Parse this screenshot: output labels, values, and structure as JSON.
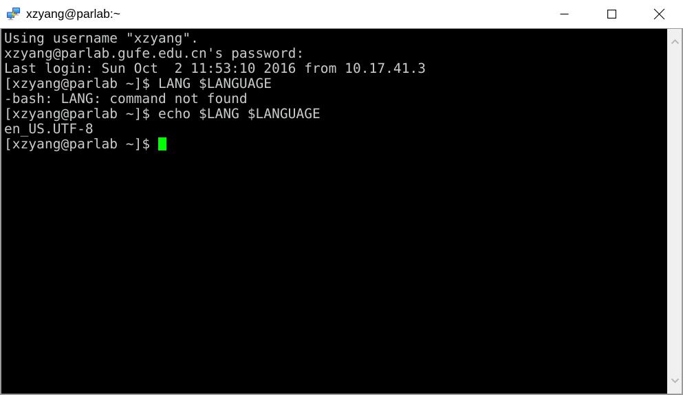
{
  "window": {
    "title": "xzyang@parlab:~",
    "icon": "putty-icon",
    "controls": {
      "minimize_label": "Minimize",
      "maximize_label": "Maximize",
      "close_label": "Close"
    }
  },
  "terminal": {
    "background_color": "#000000",
    "foreground_color": "#c8ccc8",
    "cursor_color": "#00ff00",
    "lines": [
      "Using username \"xzyang\".",
      "xzyang@parlab.gufe.edu.cn's password:",
      "Last login: Sun Oct  2 11:53:10 2016 from 10.17.41.3",
      "[xzyang@parlab ~]$ LANG $LANGUAGE",
      "-bash: LANG: command not found",
      "[xzyang@parlab ~]$ echo $LANG $LANGUAGE",
      "en_US.UTF-8"
    ],
    "prompt": "[xzyang@parlab ~]$ "
  },
  "scrollbar": {
    "up_arrow": "chevron-up-icon",
    "down_arrow": "chevron-down-icon"
  }
}
